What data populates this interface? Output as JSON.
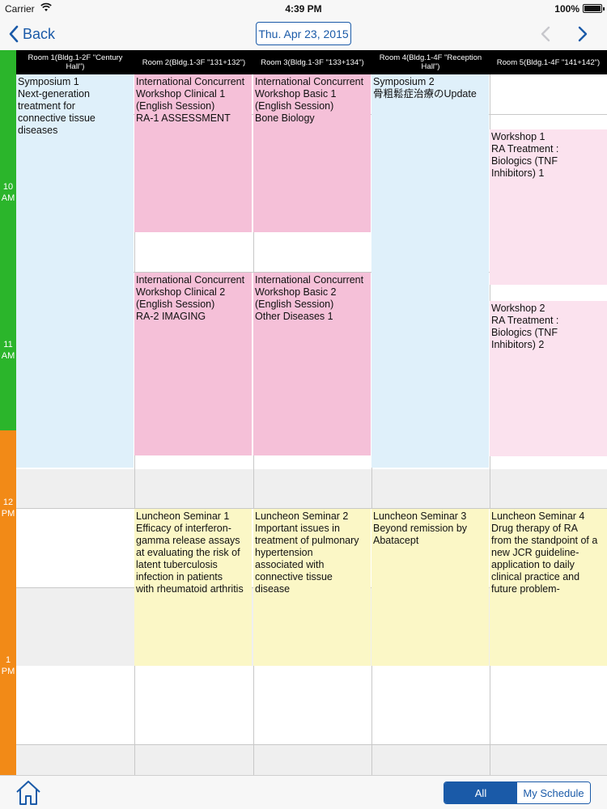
{
  "status_bar": {
    "carrier": "Carrier",
    "time": "4:39 PM",
    "battery": "100%"
  },
  "nav": {
    "back_label": "Back",
    "date_label": "Thu. Apr 23, 2015"
  },
  "rooms": [
    "Room 1(Bldg.1-2F \"Century Hall\")",
    "Room 2(Bldg.1-3F \"131+132\")",
    "Room 3(Bldg.1-3F \"133+134\")",
    "Room 4(Bldg.1-4F \"Reception Hall\")",
    "Room 5(Bldg.1-4F \"141+142\")"
  ],
  "hours": [
    {
      "hour": "10",
      "ampm": "AM"
    },
    {
      "hour": "11",
      "ampm": "AM"
    },
    {
      "hour": "12",
      "ampm": "PM"
    },
    {
      "hour": "1",
      "ampm": "PM"
    }
  ],
  "events": {
    "symposium1": [
      "Symposium 1",
      "Next-generation",
      "treatment for",
      "connective tissue",
      "diseases"
    ],
    "clinical1": [
      "International Concurrent",
      "Workshop Clinical 1",
      "(English Session)",
      "RA-1 ASSESSMENT"
    ],
    "basic1": [
      "International Concurrent",
      "Workshop Basic 1",
      "(English Session)",
      "Bone Biology"
    ],
    "symposium2": [
      "Symposium 2",
      "骨粗鬆症治療のUpdate"
    ],
    "workshop1": [
      "Workshop 1",
      "RA Treatment :",
      "Biologics (TNF",
      "Inhibitors) 1"
    ],
    "clinical2": [
      "International Concurrent",
      "Workshop Clinical 2",
      "(English Session)",
      "RA-2 IMAGING"
    ],
    "basic2": [
      "International Concurrent",
      "Workshop Basic 2",
      "(English Session)",
      "Other Diseases 1"
    ],
    "workshop2": [
      "Workshop 2",
      "RA Treatment :",
      "Biologics (TNF",
      "Inhibitors) 2"
    ],
    "luncheon1": [
      "Luncheon Seminar 1",
      "Efficacy of interferon-",
      "gamma release assays",
      "at evaluating the risk of",
      "latent tuberculosis",
      "infection in patients",
      "with rheumatoid arthritis"
    ],
    "luncheon2": [
      "Luncheon Seminar 2",
      "Important issues in",
      "treatment of pulmonary",
      "hypertension",
      "associated with",
      "connective tissue",
      "disease"
    ],
    "luncheon3": [
      "Luncheon Seminar 3",
      "Beyond remission by",
      "Abatacept"
    ],
    "luncheon4": [
      "Luncheon Seminar 4",
      "Drug therapy of RA",
      "from the standpoint of a",
      "new JCR guideline-",
      "application to daily",
      "clinical practice and",
      "future problem-"
    ]
  },
  "tabs": {
    "all_label": "All",
    "my_schedule_label": "My Schedule"
  },
  "colors": {
    "accent": "#1a5aa8",
    "morning_gutter": "#2bb52b",
    "afternoon_gutter": "#f28a17",
    "symposium": "#dff0fa",
    "workshop": "#f5c0d8",
    "luncheon": "#fbf7c6"
  }
}
